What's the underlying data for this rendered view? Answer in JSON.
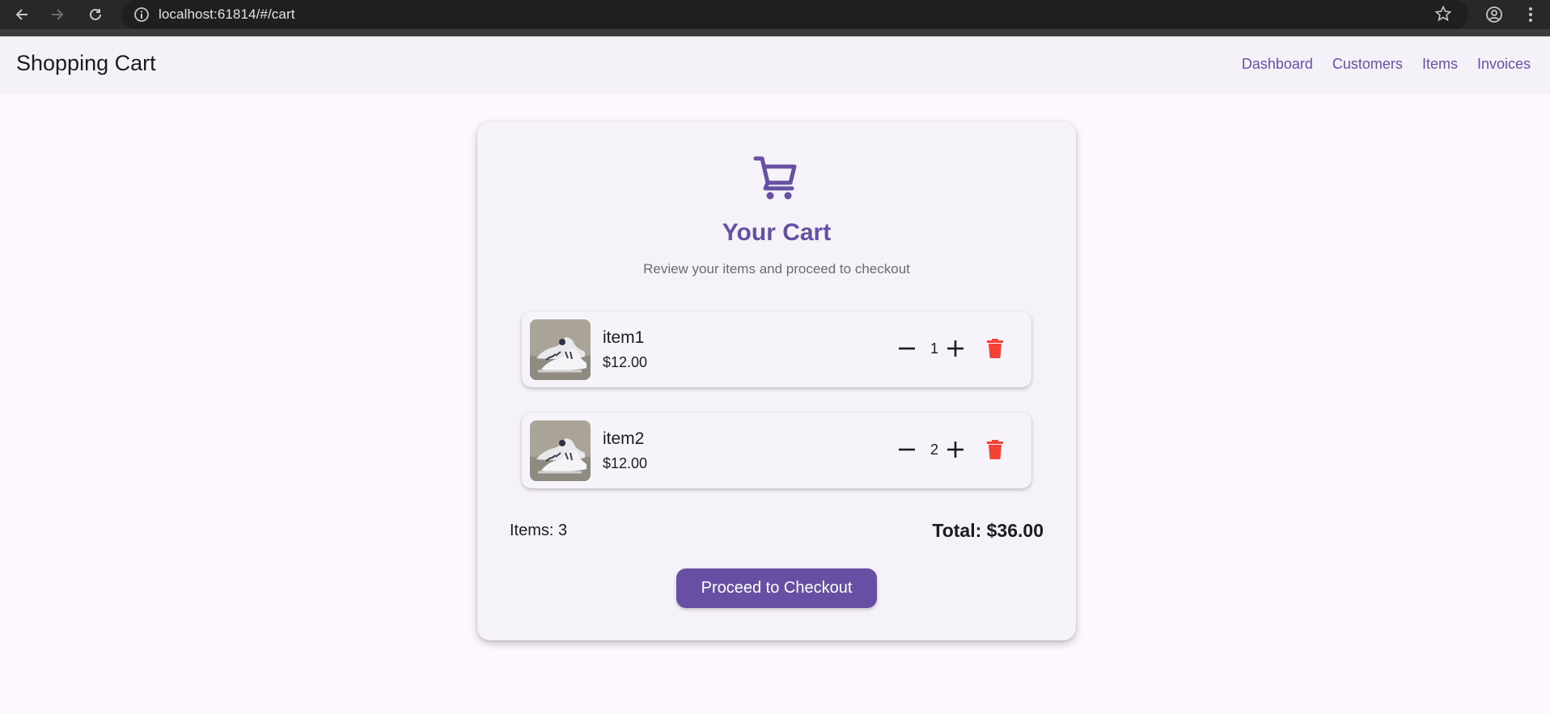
{
  "browser": {
    "url": "localhost:61814/#/cart"
  },
  "appbar": {
    "title": "Shopping Cart",
    "nav": [
      {
        "label": "Dashboard"
      },
      {
        "label": "Customers"
      },
      {
        "label": "Items"
      },
      {
        "label": "Invoices"
      }
    ]
  },
  "cart": {
    "title": "Your Cart",
    "subtitle": "Review your items and proceed to checkout",
    "items": [
      {
        "name": "item1",
        "price": "$12.00",
        "quantity": "1"
      },
      {
        "name": "item2",
        "price": "$12.00",
        "quantity": "2"
      }
    ],
    "items_count": "Items: 3",
    "total": "Total: $36.00",
    "checkout_label": "Proceed to Checkout"
  },
  "colors": {
    "primary": "#6750a4",
    "delete": "#f44336",
    "background": "#fef7ff",
    "card": "#f6f2f9"
  }
}
